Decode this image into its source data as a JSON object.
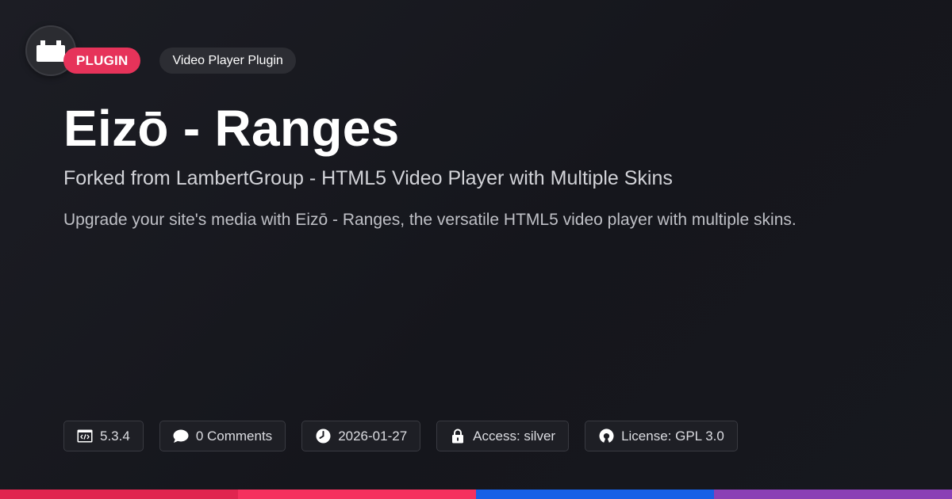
{
  "logo": {
    "icon": "plugin-block-icon"
  },
  "tags": {
    "type_label": "PLUGIN",
    "category_label": "Video Player Plugin"
  },
  "title": "Eizō - Ranges",
  "subtitle": "Forked from LambertGroup - HTML5 Video Player with Multiple Skins",
  "description": "Upgrade your site's media with Eizō - Ranges, the versatile HTML5 video player with multiple skins.",
  "meta": {
    "version": {
      "icon": "code-window-icon",
      "text": "5.3.4"
    },
    "comments": {
      "icon": "speech-bubble-icon",
      "text": "0 Comments"
    },
    "date": {
      "icon": "clock-icon",
      "text": "2026-01-27"
    },
    "access": {
      "icon": "lock-icon",
      "text": "Access: silver"
    },
    "license": {
      "icon": "open-source-icon",
      "text": "License: GPL 3.0"
    }
  },
  "colors": {
    "accent": "#e6335a",
    "bar": [
      "#e0254f",
      "#f5315e",
      "#1660e6",
      "#8a40b5"
    ]
  }
}
